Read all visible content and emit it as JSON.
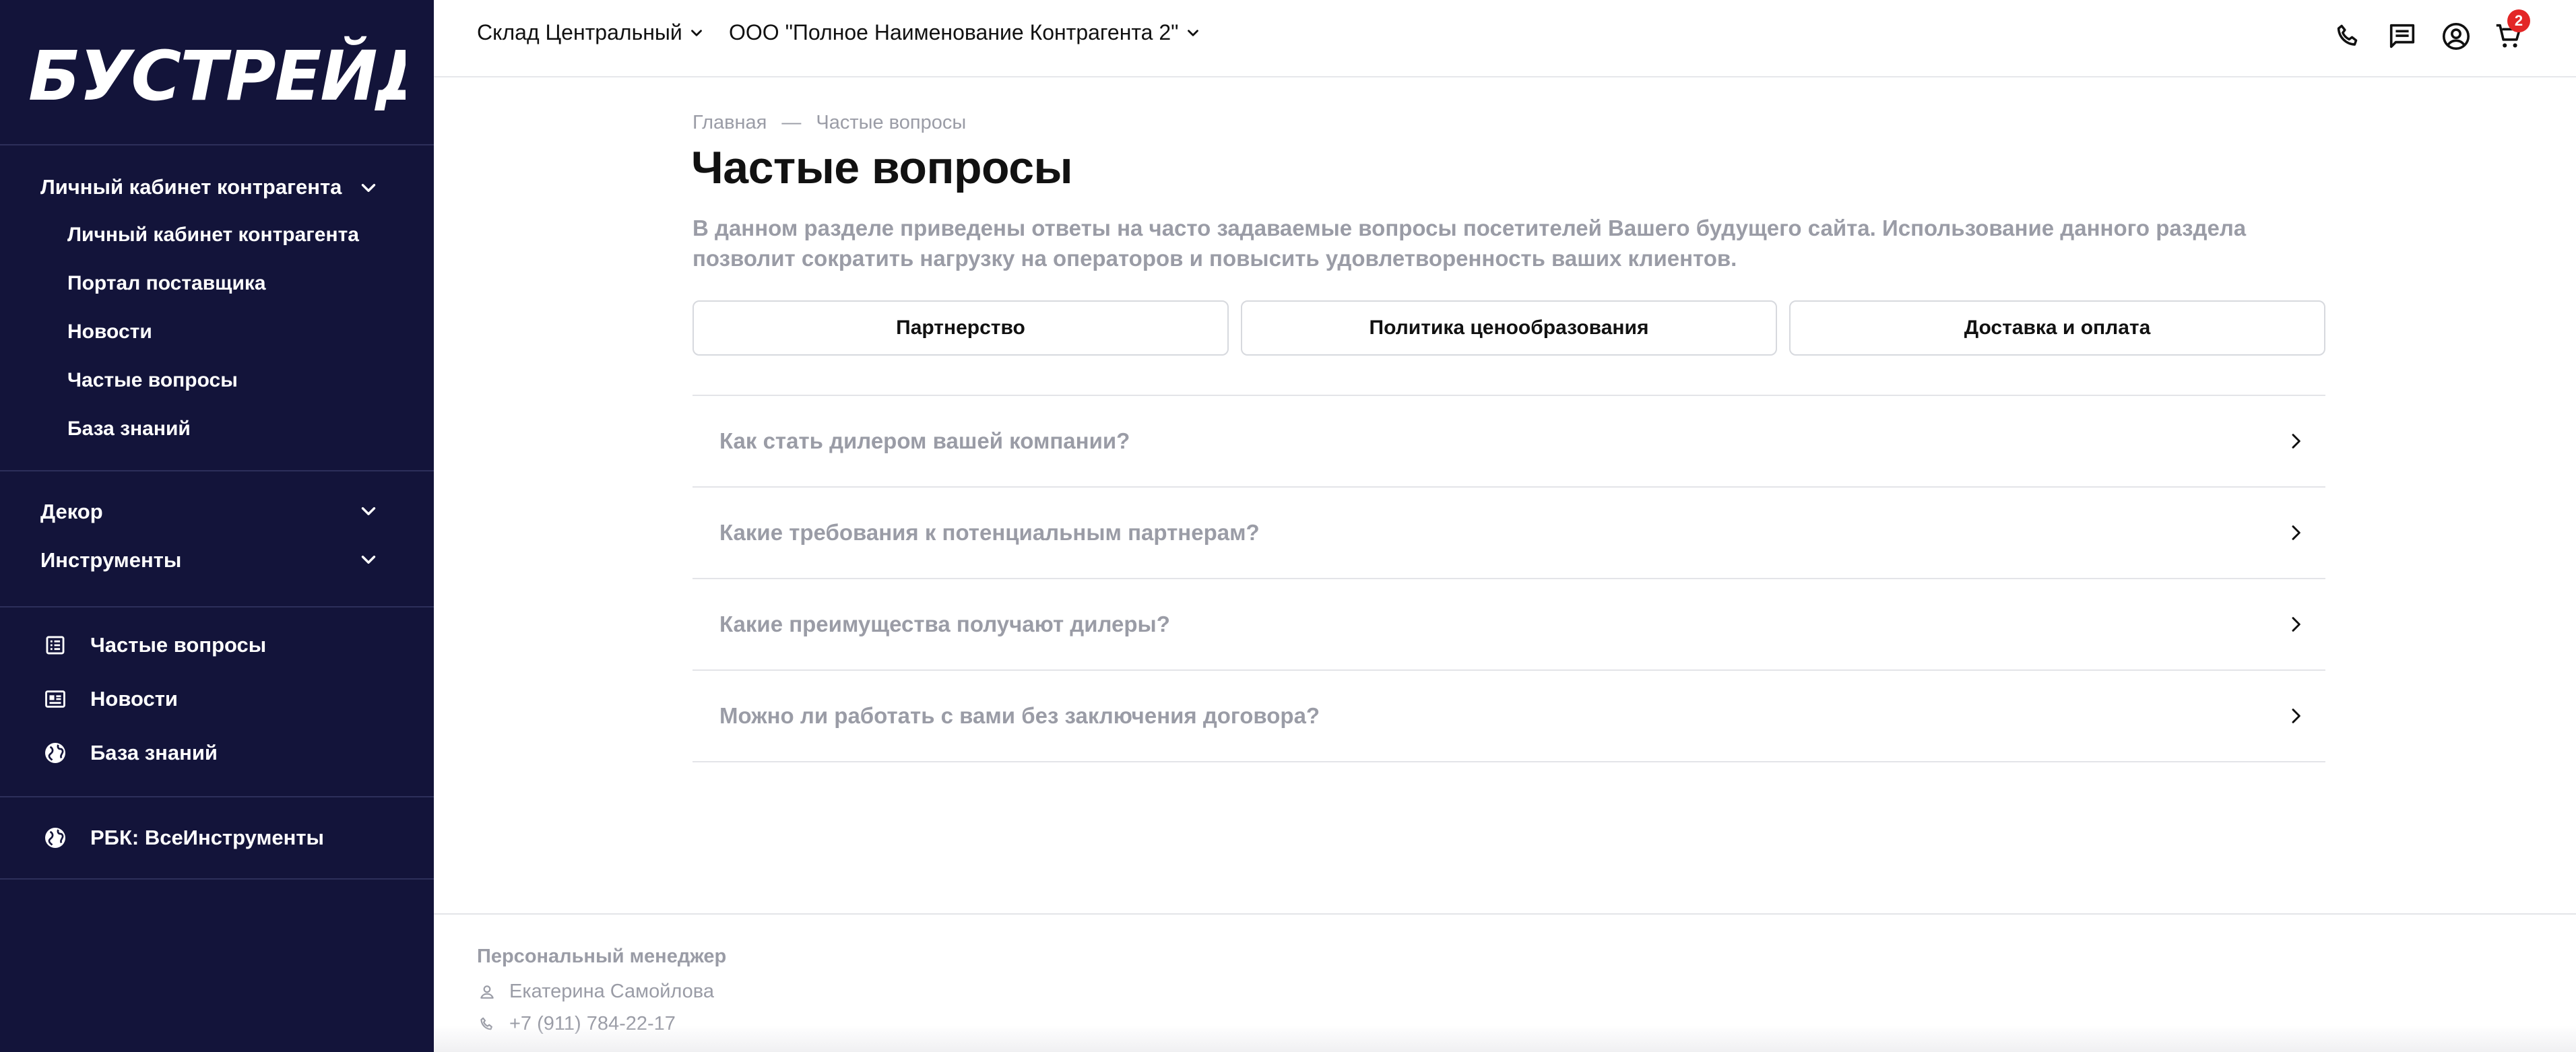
{
  "brand": {
    "logo_text": "БУСТРЕЙД"
  },
  "sidebar": {
    "cabinet": {
      "label": "Личный кабинет контрагента",
      "children": [
        "Личный кабинет контрагента",
        "Портал поставщика",
        "Новости",
        "Частые вопросы",
        "База знаний"
      ]
    },
    "categories": [
      {
        "label": "Декор"
      },
      {
        "label": "Инструменты"
      }
    ],
    "links": [
      {
        "label": "Частые вопросы",
        "icon": "document-list-icon"
      },
      {
        "label": "Новости",
        "icon": "newspaper-icon"
      },
      {
        "label": "База знаний",
        "icon": "globe-icon"
      }
    ],
    "external": {
      "label": "РБК: ВсеИнструменты",
      "icon": "globe-icon"
    }
  },
  "header": {
    "warehouse": "Склад Центральный",
    "contractor": "ООО \"Полное Наименование Контрагента 2\"",
    "icons": [
      "phone-icon",
      "chat-icon",
      "account-icon",
      "cart-icon"
    ],
    "cart_count": "2"
  },
  "main": {
    "breadcrumb": {
      "home": "Главная",
      "separator": "—",
      "current": "Частые вопросы"
    },
    "title": "Частые вопросы",
    "intro": "В данном разделе приведены ответы на часто задаваемые вопросы посетителей Вашего будущего сайта. Использование данного раздела позволит сократить нагрузку на операторов и повысить удовлетворенность ваших клиентов.",
    "tabs": [
      "Партнерство",
      "Политика ценообразования",
      "Доставка и оплата"
    ],
    "questions": [
      "Как стать дилером вашей компании?",
      "Какие требования к потенциальным партнерам?",
      "Какие преимущества получают дилеры?",
      "Можно ли работать с вами без заключения договора?"
    ]
  },
  "footer": {
    "title": "Персональный менеджер",
    "manager_name": "Екатерина Самойлова",
    "manager_phone": "+7 (911) 784-22-17"
  },
  "colors": {
    "sidebar_bg": "#13143a",
    "muted_text": "#9a9ca6",
    "badge": "#e32626"
  }
}
